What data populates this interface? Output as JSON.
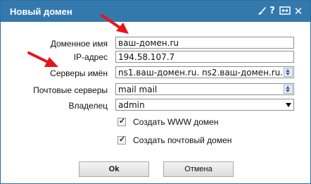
{
  "dialog": {
    "title": "Новый домен",
    "fields": {
      "domain_name": {
        "label": "Доменное имя",
        "value": "ваш-домен.ru"
      },
      "ip_address": {
        "label": "IP-адрес",
        "value": "194.58.107.7"
      },
      "name_servers": {
        "label": "Серверы имён",
        "value": "ns1.ваш-домен.ru. ns2.ваш-домен.ru."
      },
      "mail_servers": {
        "label": "Почтовые серверы",
        "value": "mail mail"
      },
      "owner": {
        "label": "Владелец",
        "value": "admin"
      }
    },
    "checkboxes": {
      "create_www": {
        "label": "Создать WWW домен",
        "checked": true
      },
      "create_mail": {
        "label": "Создать почтовый домен",
        "checked": true
      }
    },
    "buttons": {
      "ok": "Ok",
      "cancel": "Отмена"
    },
    "titlebar_icons": [
      "brush-icon",
      "help-icon",
      "maximize-icon",
      "close-icon"
    ],
    "colors": {
      "titlebar": "#3479ad",
      "arrow": "#e8141b"
    }
  }
}
